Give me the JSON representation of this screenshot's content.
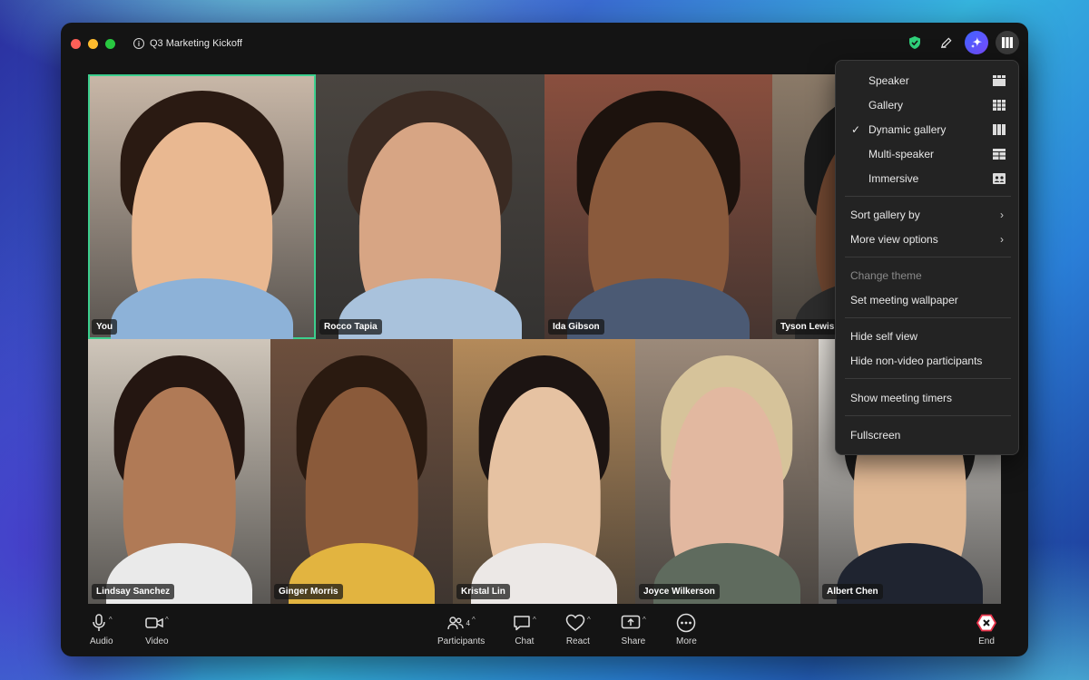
{
  "window": {
    "title": "Q3 Marketing Kickoff"
  },
  "participants": [
    {
      "name": "You",
      "skin": "#e9b891",
      "hair": "#2a1a12",
      "bg": "#c9b8a8",
      "shirt": "#8db2d8"
    },
    {
      "name": "Rocco Tapia",
      "skin": "#d7a584",
      "hair": "#3a2a22",
      "bg": "#4a4540",
      "shirt": "#a9c2dc"
    },
    {
      "name": "Ida Gibson",
      "skin": "#8a5a3c",
      "hair": "#1c120d",
      "bg": "#8a4f3e",
      "shirt": "#4b5a74"
    },
    {
      "name": "Tyson Lewis",
      "skin": "#6e4630",
      "hair": "#1a1a1a",
      "bg": "#8b7a68",
      "shirt": "#2c2c2c"
    },
    {
      "name": "Lindsay Sanchez",
      "skin": "#b07a56",
      "hair": "#241611",
      "bg": "#cfc6ba",
      "shirt": "#eaeaea"
    },
    {
      "name": "Ginger Morris",
      "skin": "#8a5a3a",
      "hair": "#2a1a10",
      "bg": "#6d4f3d",
      "shirt": "#e2b440"
    },
    {
      "name": "Kristal Lin",
      "skin": "#e6c2a2",
      "hair": "#1c1412",
      "bg": "#b48a5a",
      "shirt": "#ece8e6"
    },
    {
      "name": "Joyce Wilkerson",
      "skin": "#e2b8a0",
      "hair": "#d6c39a",
      "bg": "#9c8a7a",
      "shirt": "#5f6b5e"
    },
    {
      "name": "Albert Chen",
      "skin": "#e0b894",
      "hair": "#1a1a1a",
      "bg": "#dedad4",
      "shirt": "#1f2430"
    }
  ],
  "menu": {
    "layouts": [
      {
        "label": "Speaker",
        "checked": false,
        "icon": "speaker-layout-icon"
      },
      {
        "label": "Gallery",
        "checked": false,
        "icon": "gallery-layout-icon"
      },
      {
        "label": "Dynamic gallery",
        "checked": true,
        "icon": "dynamic-gallery-layout-icon"
      },
      {
        "label": "Multi-speaker",
        "checked": false,
        "icon": "multi-speaker-layout-icon"
      },
      {
        "label": "Immersive",
        "checked": false,
        "icon": "immersive-layout-icon"
      }
    ],
    "sort_gallery": "Sort gallery by",
    "more_view_options": "More view options",
    "change_theme": "Change theme",
    "set_wallpaper": "Set meeting wallpaper",
    "hide_self_view": "Hide self view",
    "hide_non_video": "Hide non-video participants",
    "show_timers": "Show meeting timers",
    "fullscreen": "Fullscreen",
    "check_mark": "✓",
    "submenu_arrow": "›"
  },
  "toolbar": {
    "audio": "Audio",
    "video": "Video",
    "participants": "Participants",
    "participants_count": "4",
    "chat": "Chat",
    "react": "React",
    "share": "Share",
    "more": "More",
    "end": "End",
    "caret": "^"
  },
  "colors": {
    "active_speaker": "#3ccf8e",
    "end_button": "#e8334a",
    "shield": "#2fd07a"
  }
}
